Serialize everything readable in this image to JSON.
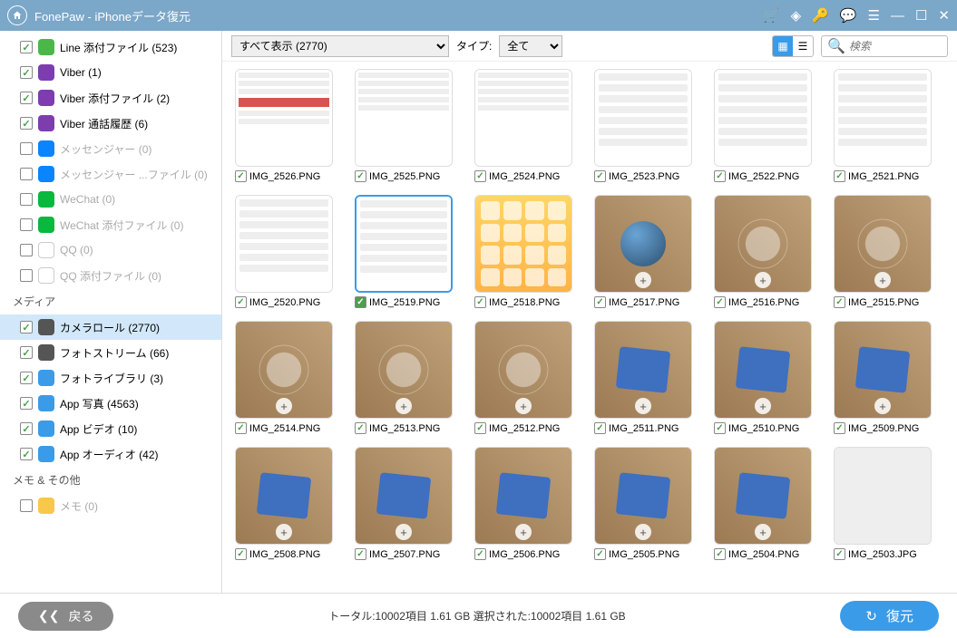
{
  "title": "FonePaw - iPhoneデータ復元",
  "sidebar": {
    "items": [
      {
        "label": "Line 添付ファイル (523)",
        "checked": true,
        "enabled": true,
        "icon": "ic-line"
      },
      {
        "label": "Viber (1)",
        "checked": true,
        "enabled": true,
        "icon": "ic-viber"
      },
      {
        "label": "Viber 添付ファイル (2)",
        "checked": true,
        "enabled": true,
        "icon": "ic-viber"
      },
      {
        "label": "Viber 通話履歴 (6)",
        "checked": true,
        "enabled": true,
        "icon": "ic-viber"
      },
      {
        "label": "メッセンジャー (0)",
        "checked": false,
        "enabled": false,
        "icon": "ic-messenger"
      },
      {
        "label": "メッセンジャー ...ファイル (0)",
        "checked": false,
        "enabled": false,
        "icon": "ic-messenger"
      },
      {
        "label": "WeChat (0)",
        "checked": false,
        "enabled": false,
        "icon": "ic-wechat"
      },
      {
        "label": "WeChat 添付ファイル (0)",
        "checked": false,
        "enabled": false,
        "icon": "ic-wechat"
      },
      {
        "label": "QQ (0)",
        "checked": false,
        "enabled": false,
        "icon": "ic-qq"
      },
      {
        "label": "QQ 添付ファイル (0)",
        "checked": false,
        "enabled": false,
        "icon": "ic-qq"
      }
    ],
    "media_header": "メディア",
    "media_items": [
      {
        "label": "カメラロール (2770)",
        "checked": true,
        "enabled": true,
        "icon": "ic-photo",
        "selected": true
      },
      {
        "label": "フォトストリーム (66)",
        "checked": true,
        "enabled": true,
        "icon": "ic-photo"
      },
      {
        "label": "フォトライブラリ (3)",
        "checked": true,
        "enabled": true,
        "icon": "ic-photolib"
      },
      {
        "label": "App 写真 (4563)",
        "checked": true,
        "enabled": true,
        "icon": "ic-app"
      },
      {
        "label": "App ビデオ (10)",
        "checked": true,
        "enabled": true,
        "icon": "ic-video"
      },
      {
        "label": "App オーディオ (42)",
        "checked": true,
        "enabled": true,
        "icon": "ic-audio"
      }
    ],
    "memo_header": "メモ & その他",
    "memo_items": [
      {
        "label": "メモ (0)",
        "checked": false,
        "enabled": false,
        "icon": "ic-memo"
      }
    ]
  },
  "toolbar": {
    "filter_selected": "すべて表示 (2770)",
    "type_label": "タイプ:",
    "type_selected": "全て",
    "search_placeholder": "検索"
  },
  "grid": {
    "rows": [
      [
        {
          "name": "IMG_2526.PNG",
          "kind": "head-red"
        },
        {
          "name": "IMG_2525.PNG",
          "kind": "head"
        },
        {
          "name": "IMG_2524.PNG",
          "kind": "head"
        },
        {
          "name": "IMG_2523.PNG",
          "kind": "settings"
        },
        {
          "name": "IMG_2522.PNG",
          "kind": "settings"
        },
        {
          "name": "IMG_2521.PNG",
          "kind": "settings"
        }
      ],
      [
        {
          "name": "IMG_2520.PNG",
          "kind": "settings"
        },
        {
          "name": "IMG_2519.PNG",
          "kind": "settings",
          "selected": true
        },
        {
          "name": "IMG_2518.PNG",
          "kind": "icons"
        },
        {
          "name": "IMG_2517.PNG",
          "kind": "sphere"
        },
        {
          "name": "IMG_2516.PNG",
          "kind": "rings"
        },
        {
          "name": "IMG_2515.PNG",
          "kind": "rings"
        }
      ],
      [
        {
          "name": "IMG_2514.PNG",
          "kind": "rings"
        },
        {
          "name": "IMG_2513.PNG",
          "kind": "rings"
        },
        {
          "name": "IMG_2512.PNG",
          "kind": "rings"
        },
        {
          "name": "IMG_2511.PNG",
          "kind": "cloth"
        },
        {
          "name": "IMG_2510.PNG",
          "kind": "cloth"
        },
        {
          "name": "IMG_2509.PNG",
          "kind": "cloth"
        }
      ],
      [
        {
          "name": "IMG_2508.PNG",
          "kind": "cloth"
        },
        {
          "name": "IMG_2507.PNG",
          "kind": "cloth"
        },
        {
          "name": "IMG_2506.PNG",
          "kind": "cloth"
        },
        {
          "name": "IMG_2505.PNG",
          "kind": "cloth"
        },
        {
          "name": "IMG_2504.PNG",
          "kind": "cloth"
        },
        {
          "name": "IMG_2503.JPG",
          "kind": "plain"
        }
      ]
    ]
  },
  "footer": {
    "back_label": "戻る",
    "stats": "トータル:10002項目 1.61 GB   選択された:10002項目 1.61 GB",
    "restore_label": "復元"
  }
}
